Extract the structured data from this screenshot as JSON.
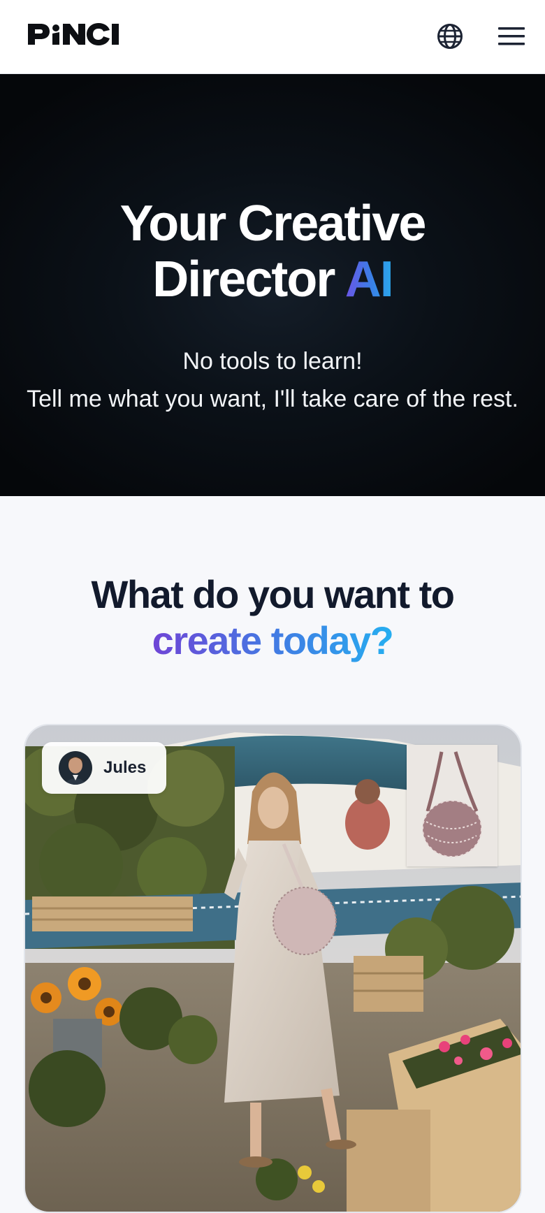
{
  "header": {
    "logo_text": "PINCI",
    "language_icon": "globe-icon",
    "menu_icon": "hamburger-menu-icon"
  },
  "hero": {
    "title_line1": "Your Creative",
    "title_line2_prefix": "Director ",
    "title_line2_accent": "AI",
    "subtitle_line1": "No tools to learn!",
    "subtitle_line2": "Tell me what you want, I'll take care of the rest."
  },
  "create": {
    "title_line1": "What do you want to",
    "title_line2": "create today?"
  },
  "showcase": {
    "user_name": "Jules",
    "avatar_icon": "avatar",
    "product_thumbnail": "crochet-bag-thumbnail"
  },
  "colors": {
    "hero_bg": "#05070a",
    "accent_start": "#6f45d6",
    "accent_end": "#26aef0",
    "heading_dark": "#121a2c"
  }
}
